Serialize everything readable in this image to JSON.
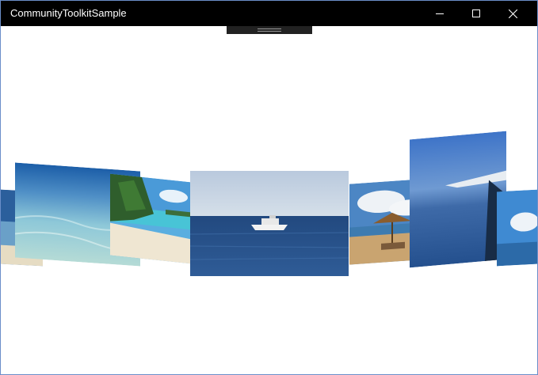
{
  "window": {
    "title": "CommunityToolkitSample"
  },
  "caption_buttons": [
    "minimize-icon",
    "maximize-icon",
    "close-icon"
  ],
  "carousel": {
    "items": [
      {
        "icon": "beach-edge-image"
      },
      {
        "icon": "shallow-water-image"
      },
      {
        "icon": "palm-beach-image"
      },
      {
        "icon": "boat-sea-image"
      },
      {
        "icon": "beach-umbrella-image"
      },
      {
        "icon": "airplane-wing-image"
      },
      {
        "icon": "sky-edge-image"
      }
    ],
    "selected_index": 3
  }
}
